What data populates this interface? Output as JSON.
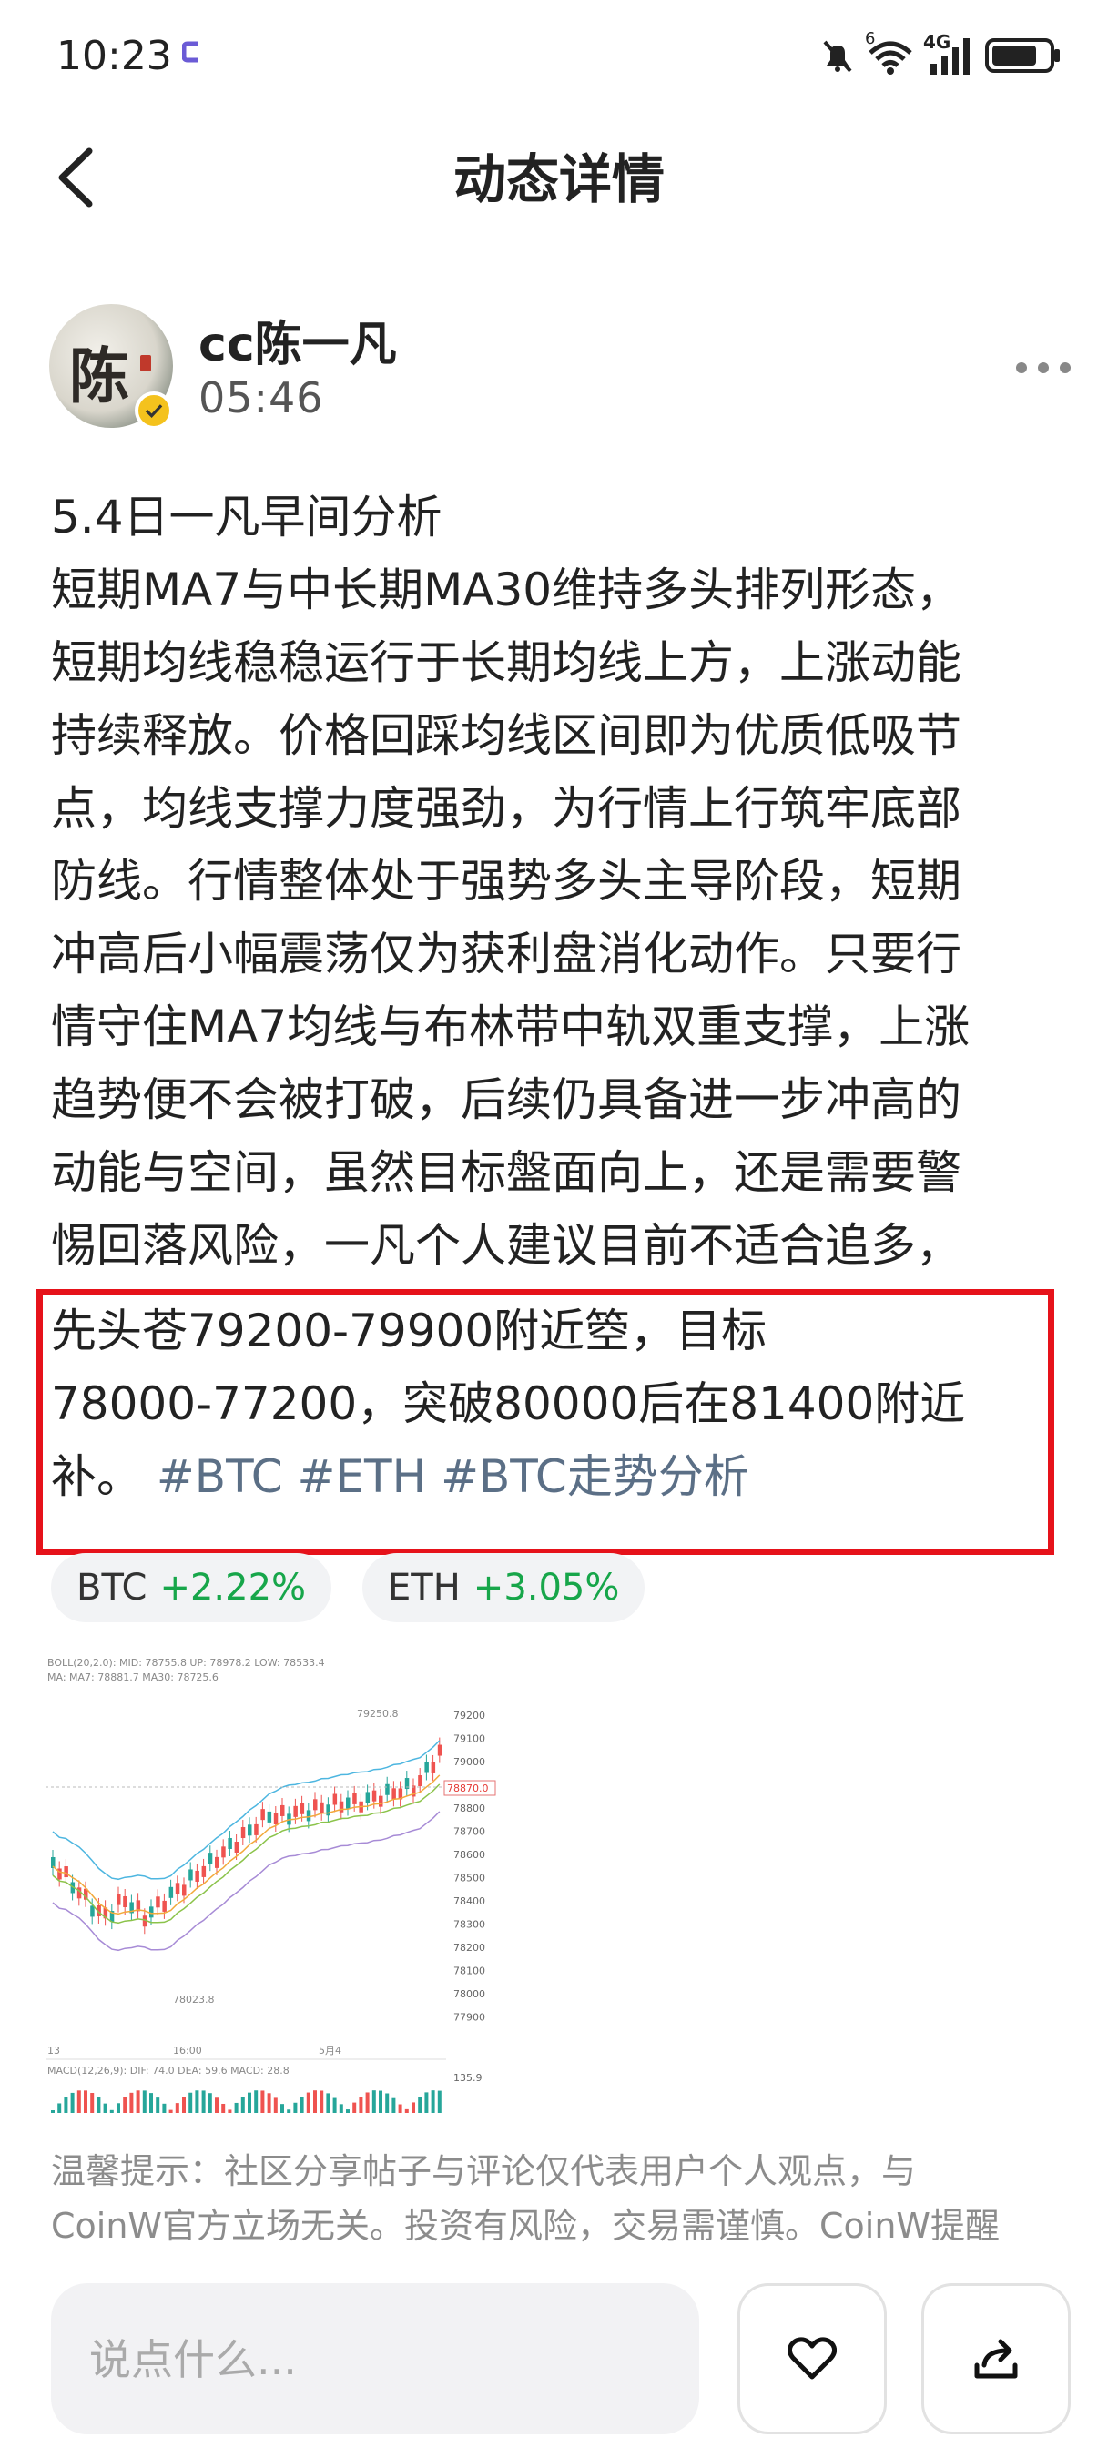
{
  "status_bar": {
    "time": "10:23",
    "wifi_label": "6",
    "network": "4G",
    "battery_level": 0.8
  },
  "header": {
    "title": "动态详情"
  },
  "post": {
    "author": "cc陈一凡",
    "avatar_text": "陈",
    "time": "05:46",
    "lines": [
      "5.4日一凡早间分析",
      "短期MA7与中长期MA30维持多头排列形态，",
      "短期均线稳稳运行于长期均线上方，上涨动能",
      "持续释放。价格回踩均线区间即为优质低吸节",
      "点，均线支撑力度强劲，为行情上行筑牢底部",
      "防线。行情整体处于强势多头主导阶段，短期",
      "冲高后小幅震荡仅为获利盘消化动作。只要行",
      "情守住MA7均线与布林带中轨双重支撑，上涨",
      "趋势便不会被打破，后续仍具备进一步冲高的",
      "动能与空间，虽然目标盤面向上，还是需要警",
      "惕回落风险，一凡个人建议目前不适合追多，",
      "先头苍79200-79900附近箜，目标",
      "78000-77200，突破80000后在81400附近"
    ],
    "last_line_prefix": "补。",
    "tags": [
      "#BTC",
      "#ETH",
      "#BTC走势分析"
    ]
  },
  "coins": [
    {
      "name": "BTC",
      "change": "+2.22%"
    },
    {
      "name": "ETH",
      "change": "+3.05%"
    }
  ],
  "chart_thumb": {
    "boll_label": "BOLL(20,2.0): MID: 78755.8  UP: 78978.2  LOW: 78533.4",
    "ma_label": "MA: MA7: 78881.7  MA30: 78725.6",
    "price_axis": [
      "79200",
      "79100",
      "79000",
      "78900",
      "78800",
      "78700",
      "78600",
      "78500",
      "78400",
      "78300",
      "78200",
      "78100",
      "78000",
      "77900"
    ],
    "high_label": "79250.8",
    "low_label": "78023.8",
    "last_price": "78870.0",
    "time_labels": [
      "13",
      "16:00",
      "5月4"
    ],
    "macd_label": "MACD(12,26,9): DIF: 74.0  DEA: 59.6  MACD: 28.8",
    "macd_axis": "135.9",
    "colors": {
      "up": "#26a69a",
      "down": "#ef5350",
      "mid": "#f2a93b",
      "upper": "#4db6e0",
      "lower": "#a78bd6",
      "ma7": "#8bc34a"
    }
  },
  "disclaimer": {
    "line1": "温馨提示：社区分享帖子与评论仅代表用户个人观点，与",
    "line2": "CoinW官方立场无关。投资有风险，交易需谨慎。CoinW提醒"
  },
  "bottom_bar": {
    "comment_placeholder": "说点什么..."
  },
  "colors": {
    "highlight_border": "#e6121a",
    "positive": "#17a64a",
    "tag": "#5b6f86"
  }
}
